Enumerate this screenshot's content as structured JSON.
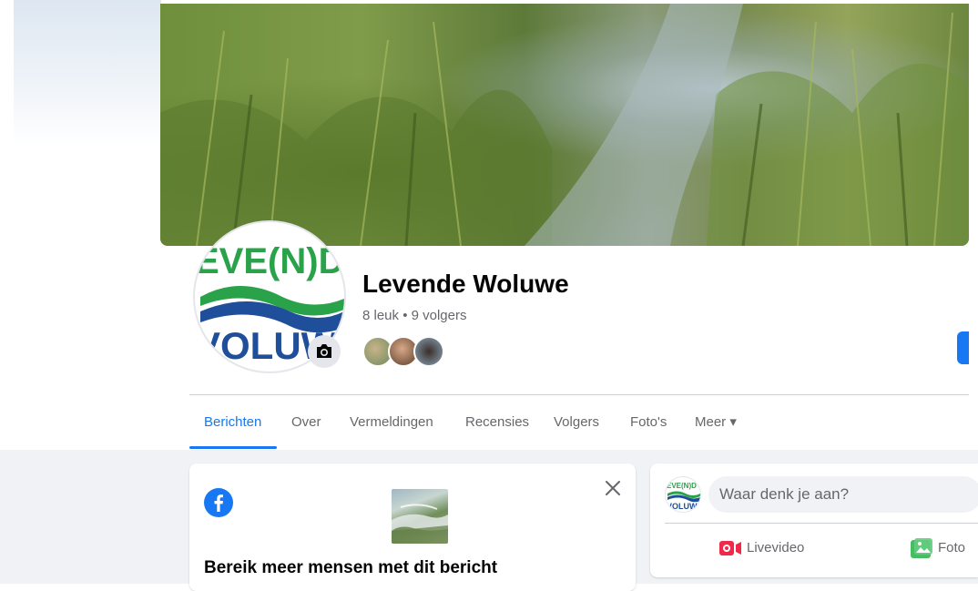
{
  "page": {
    "name": "Levende Woluwe",
    "stats": "8 leuk • 9 volgers"
  },
  "logo": {
    "line1": "EVE(N)D",
    "line2": "VOLUW",
    "colors": {
      "green": "#2aa24a",
      "blue": "#1f4e9a"
    }
  },
  "tabs": [
    {
      "label": "Berichten",
      "active": true
    },
    {
      "label": "Over"
    },
    {
      "label": "Vermeldingen"
    },
    {
      "label": "Recensies"
    },
    {
      "label": "Volgers"
    },
    {
      "label": "Foto's"
    },
    {
      "label": "Meer ▾"
    }
  ],
  "boost_card": {
    "title": "Bereik meer mensen met dit bericht"
  },
  "composer": {
    "placeholder": "Waar denk je aan?",
    "actions": [
      "Livevideo",
      "Foto"
    ]
  },
  "colors": {
    "accent": "#1877f2",
    "background": "#f0f2f5",
    "secondary_text": "#65676b",
    "live_red": "#f02849",
    "photo_green": "#45bd62"
  }
}
